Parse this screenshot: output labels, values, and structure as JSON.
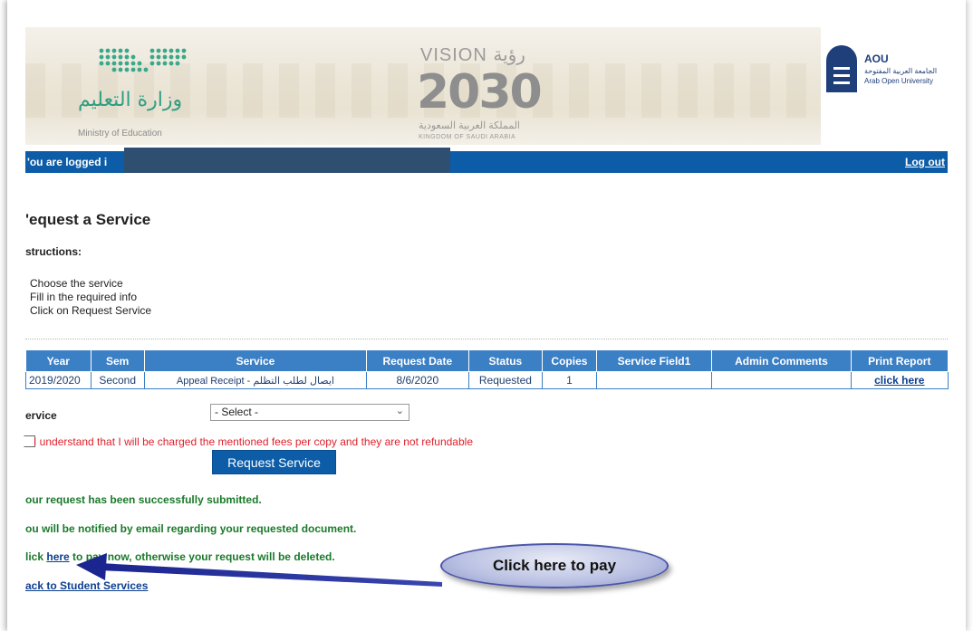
{
  "header": {
    "moe_arabic": "وزارة التعليم",
    "moe_english": "Ministry of Education",
    "vision_top": "VISION رؤية",
    "vision_year": "2030",
    "vision_arabic": "المملكة العربية السعودية",
    "vision_english": "KINGDOM OF SAUDI ARABIA",
    "aou_name": "AOU",
    "aou_arabic": "الجامعة العربية المفتوحة",
    "aou_english": "Arab Open University"
  },
  "topbar": {
    "logged_text": "'ou are logged i",
    "logout": "Log out"
  },
  "page": {
    "title": "'equest a Service",
    "instructions_heading": "structions:",
    "steps": [
      "Choose the service",
      "Fill in the required info",
      "Click on Request Service"
    ]
  },
  "table": {
    "headers": [
      "Year",
      "Sem",
      "Service",
      "Request Date",
      "Status",
      "Copies",
      "Service Field1",
      "Admin Comments",
      "Print Report"
    ],
    "row": {
      "year": "2019/2020",
      "sem": "Second",
      "service": "Appeal Receipt - ايصال لطلب التظلم",
      "request_date": "8/6/2020",
      "status": "Requested",
      "copies": "1",
      "field1": "",
      "admin_comments": "",
      "print": "click here"
    }
  },
  "form": {
    "service_label": "ervice",
    "select_value": "- Select -",
    "fees_text": "I understand that I will be charged the mentioned fees per copy and they are not refundable",
    "request_button": "Request Service"
  },
  "messages": {
    "submitted": "our request has been successfully submitted.",
    "notified": "ou will be notified by email regarding your requested document.",
    "pay_prefix": "lick ",
    "pay_link": "here",
    "pay_suffix": " to pay now, otherwise your request will be deleted.",
    "back_link": "ack to Student Services"
  },
  "callout": {
    "text": "Click here to pay"
  },
  "colors": {
    "bar_blue": "#0c5ca8",
    "table_header": "#3b7fc4",
    "success_green": "#1a7a2a",
    "warning_red": "#e0202a",
    "arrow_blue": "#1f2c9a"
  }
}
